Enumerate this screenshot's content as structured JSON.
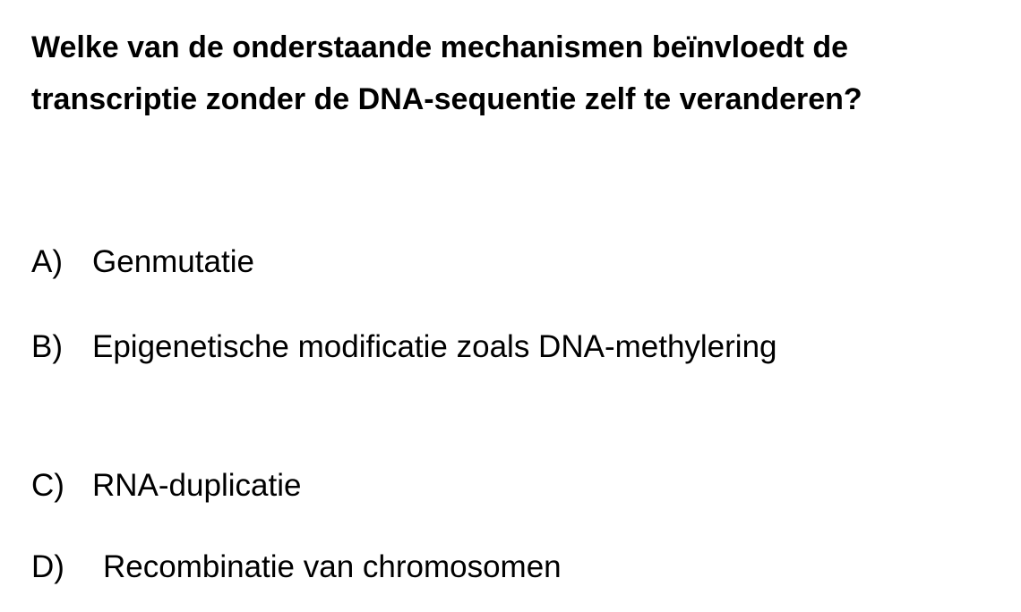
{
  "question": {
    "line1": "Welke van de onderstaande mechanismen beïnvloedt de",
    "line2": "transcriptie zonder de DNA-sequentie zelf te veranderen?"
  },
  "options": [
    {
      "letter": "A)",
      "text": "Genmutatie"
    },
    {
      "letter": "B)",
      "text": "Epigenetische modificatie zoals DNA-methylering"
    },
    {
      "letter": "C)",
      "text": "RNA-duplicatie"
    },
    {
      "letter": "D)",
      "text": "Recombinatie van chromosomen"
    }
  ]
}
